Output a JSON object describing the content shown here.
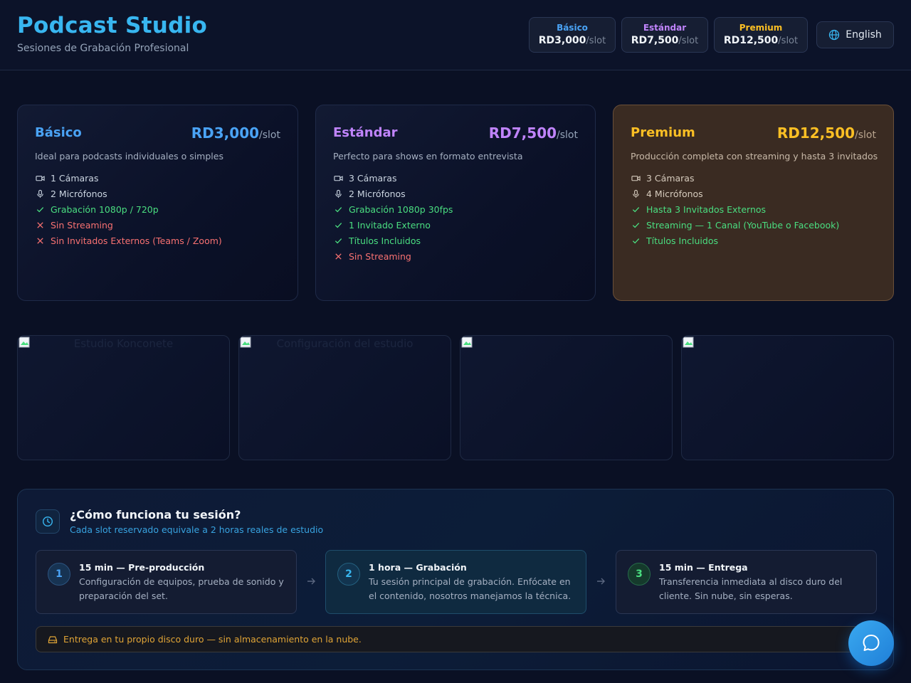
{
  "header": {
    "title": "Podcast Studio",
    "subtitle": "Sesiones de Grabación Profesional",
    "price_pills": [
      {
        "name": "Básico",
        "price": "RD3,000",
        "unit": "/slot",
        "color": "#4aa3f5"
      },
      {
        "name": "Estándar",
        "price": "RD7,500",
        "unit": "/slot",
        "color": "#c084fc"
      },
      {
        "name": "Premium",
        "price": "RD12,500",
        "unit": "/slot",
        "color": "#fbbf24"
      }
    ],
    "language_button": "English"
  },
  "plans": [
    {
      "name": "Básico",
      "price": "RD3,000",
      "unit": "/slot",
      "color": "#4aa3f5",
      "description": "Ideal para podcasts individuales o simples",
      "features": [
        {
          "text": "1 Cámaras",
          "type": "camera"
        },
        {
          "text": "2 Micrófonos",
          "type": "mic"
        },
        {
          "text": "Grabación 1080p / 720p",
          "type": "yes"
        },
        {
          "text": "Sin Streaming",
          "type": "no"
        },
        {
          "text": "Sin Invitados Externos (Teams / Zoom)",
          "type": "no"
        }
      ]
    },
    {
      "name": "Estándar",
      "price": "RD7,500",
      "unit": "/slot",
      "color": "#c084fc",
      "description": "Perfecto para shows en formato entrevista",
      "features": [
        {
          "text": "3 Cámaras",
          "type": "camera"
        },
        {
          "text": "2 Micrófonos",
          "type": "mic"
        },
        {
          "text": "Grabación 1080p 30fps",
          "type": "yes"
        },
        {
          "text": "1 Invitado Externo",
          "type": "yes"
        },
        {
          "text": "Títulos Incluidos",
          "type": "yes"
        },
        {
          "text": "Sin Streaming",
          "type": "no"
        }
      ]
    },
    {
      "name": "Premium",
      "price": "RD12,500",
      "unit": "/slot",
      "color": "#fbbf24",
      "description": "Producción completa con streaming y hasta 3 invitados",
      "features": [
        {
          "text": "3 Cámaras",
          "type": "camera"
        },
        {
          "text": "4 Micrófonos",
          "type": "mic"
        },
        {
          "text": "Hasta 3 Invitados Externos",
          "type": "yes"
        },
        {
          "text": "Streaming — 1 Canal (YouTube o Facebook)",
          "type": "yes"
        },
        {
          "text": "Títulos Incluidos",
          "type": "yes"
        }
      ]
    }
  ],
  "gallery": [
    {
      "alt": "Estudio Konconete"
    },
    {
      "alt": "Configuración del estudio"
    },
    {
      "alt": ""
    },
    {
      "alt": ""
    }
  ],
  "how": {
    "title": "¿Cómo funciona tu sesión?",
    "subtitle": "Cada slot reservado equivale a 2 horas reales de estudio",
    "steps": [
      {
        "num": "1",
        "title": "15 min — Pre-producción",
        "desc": "Configuración de equipos, prueba de sonido y preparación del set.",
        "color": "#4aa3f5"
      },
      {
        "num": "2",
        "title": "1 hora — Grabación",
        "desc": "Tu sesión principal de grabación. Enfócate en el contenido, nosotros manejamos la técnica.",
        "color": "#38b6f0"
      },
      {
        "num": "3",
        "title": "15 min — Entrega",
        "desc": "Transferencia inmediata al disco duro del cliente. Sin nube, sin esperas.",
        "color": "#4ade80"
      }
    ],
    "delivery_note": "Entrega en tu propio disco duro — sin almacenamiento en la nube."
  },
  "icons": {
    "camera": "video-camera-icon",
    "mic": "microphone-icon",
    "yes": "check-icon",
    "no": "x-icon",
    "globe": "globe-icon",
    "clock": "clock-icon",
    "drive": "hard-drive-icon",
    "chat": "chat-bubble-icon"
  }
}
